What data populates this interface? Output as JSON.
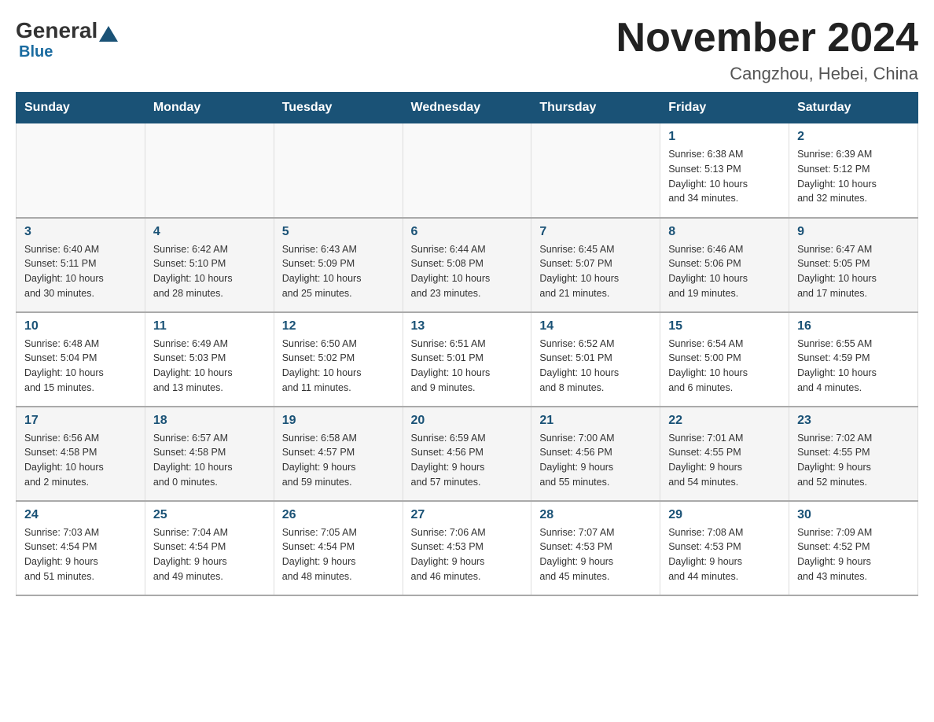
{
  "header": {
    "logo": {
      "general": "General",
      "blue": "Blue"
    },
    "title": "November 2024",
    "location": "Cangzhou, Hebei, China"
  },
  "weekdays": [
    "Sunday",
    "Monday",
    "Tuesday",
    "Wednesday",
    "Thursday",
    "Friday",
    "Saturday"
  ],
  "weeks": [
    [
      {
        "day": null,
        "info": null
      },
      {
        "day": null,
        "info": null
      },
      {
        "day": null,
        "info": null
      },
      {
        "day": null,
        "info": null
      },
      {
        "day": null,
        "info": null
      },
      {
        "day": "1",
        "info": "Sunrise: 6:38 AM\nSunset: 5:13 PM\nDaylight: 10 hours\nand 34 minutes."
      },
      {
        "day": "2",
        "info": "Sunrise: 6:39 AM\nSunset: 5:12 PM\nDaylight: 10 hours\nand 32 minutes."
      }
    ],
    [
      {
        "day": "3",
        "info": "Sunrise: 6:40 AM\nSunset: 5:11 PM\nDaylight: 10 hours\nand 30 minutes."
      },
      {
        "day": "4",
        "info": "Sunrise: 6:42 AM\nSunset: 5:10 PM\nDaylight: 10 hours\nand 28 minutes."
      },
      {
        "day": "5",
        "info": "Sunrise: 6:43 AM\nSunset: 5:09 PM\nDaylight: 10 hours\nand 25 minutes."
      },
      {
        "day": "6",
        "info": "Sunrise: 6:44 AM\nSunset: 5:08 PM\nDaylight: 10 hours\nand 23 minutes."
      },
      {
        "day": "7",
        "info": "Sunrise: 6:45 AM\nSunset: 5:07 PM\nDaylight: 10 hours\nand 21 minutes."
      },
      {
        "day": "8",
        "info": "Sunrise: 6:46 AM\nSunset: 5:06 PM\nDaylight: 10 hours\nand 19 minutes."
      },
      {
        "day": "9",
        "info": "Sunrise: 6:47 AM\nSunset: 5:05 PM\nDaylight: 10 hours\nand 17 minutes."
      }
    ],
    [
      {
        "day": "10",
        "info": "Sunrise: 6:48 AM\nSunset: 5:04 PM\nDaylight: 10 hours\nand 15 minutes."
      },
      {
        "day": "11",
        "info": "Sunrise: 6:49 AM\nSunset: 5:03 PM\nDaylight: 10 hours\nand 13 minutes."
      },
      {
        "day": "12",
        "info": "Sunrise: 6:50 AM\nSunset: 5:02 PM\nDaylight: 10 hours\nand 11 minutes."
      },
      {
        "day": "13",
        "info": "Sunrise: 6:51 AM\nSunset: 5:01 PM\nDaylight: 10 hours\nand 9 minutes."
      },
      {
        "day": "14",
        "info": "Sunrise: 6:52 AM\nSunset: 5:01 PM\nDaylight: 10 hours\nand 8 minutes."
      },
      {
        "day": "15",
        "info": "Sunrise: 6:54 AM\nSunset: 5:00 PM\nDaylight: 10 hours\nand 6 minutes."
      },
      {
        "day": "16",
        "info": "Sunrise: 6:55 AM\nSunset: 4:59 PM\nDaylight: 10 hours\nand 4 minutes."
      }
    ],
    [
      {
        "day": "17",
        "info": "Sunrise: 6:56 AM\nSunset: 4:58 PM\nDaylight: 10 hours\nand 2 minutes."
      },
      {
        "day": "18",
        "info": "Sunrise: 6:57 AM\nSunset: 4:58 PM\nDaylight: 10 hours\nand 0 minutes."
      },
      {
        "day": "19",
        "info": "Sunrise: 6:58 AM\nSunset: 4:57 PM\nDaylight: 9 hours\nand 59 minutes."
      },
      {
        "day": "20",
        "info": "Sunrise: 6:59 AM\nSunset: 4:56 PM\nDaylight: 9 hours\nand 57 minutes."
      },
      {
        "day": "21",
        "info": "Sunrise: 7:00 AM\nSunset: 4:56 PM\nDaylight: 9 hours\nand 55 minutes."
      },
      {
        "day": "22",
        "info": "Sunrise: 7:01 AM\nSunset: 4:55 PM\nDaylight: 9 hours\nand 54 minutes."
      },
      {
        "day": "23",
        "info": "Sunrise: 7:02 AM\nSunset: 4:55 PM\nDaylight: 9 hours\nand 52 minutes."
      }
    ],
    [
      {
        "day": "24",
        "info": "Sunrise: 7:03 AM\nSunset: 4:54 PM\nDaylight: 9 hours\nand 51 minutes."
      },
      {
        "day": "25",
        "info": "Sunrise: 7:04 AM\nSunset: 4:54 PM\nDaylight: 9 hours\nand 49 minutes."
      },
      {
        "day": "26",
        "info": "Sunrise: 7:05 AM\nSunset: 4:54 PM\nDaylight: 9 hours\nand 48 minutes."
      },
      {
        "day": "27",
        "info": "Sunrise: 7:06 AM\nSunset: 4:53 PM\nDaylight: 9 hours\nand 46 minutes."
      },
      {
        "day": "28",
        "info": "Sunrise: 7:07 AM\nSunset: 4:53 PM\nDaylight: 9 hours\nand 45 minutes."
      },
      {
        "day": "29",
        "info": "Sunrise: 7:08 AM\nSunset: 4:53 PM\nDaylight: 9 hours\nand 44 minutes."
      },
      {
        "day": "30",
        "info": "Sunrise: 7:09 AM\nSunset: 4:52 PM\nDaylight: 9 hours\nand 43 minutes."
      }
    ]
  ]
}
